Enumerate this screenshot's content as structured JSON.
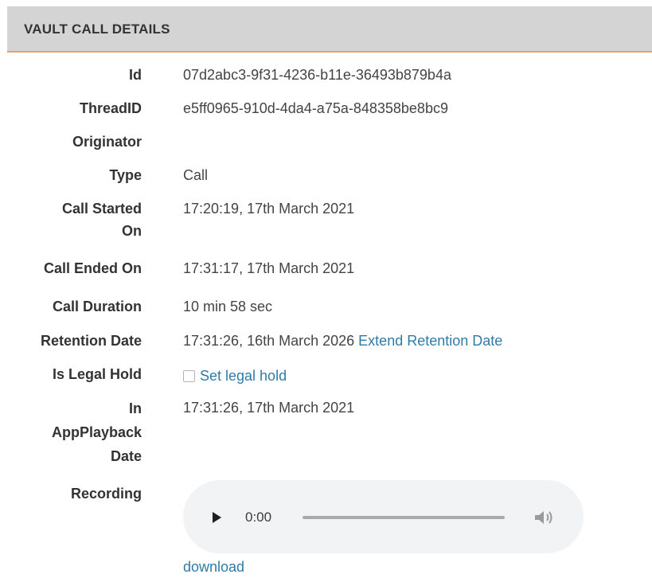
{
  "header": {
    "title": "VAULT CALL DETAILS"
  },
  "fields": {
    "id": {
      "label": "Id",
      "value": "07d2abc3-9f31-4236-b11e-36493b879b4a"
    },
    "thread_id": {
      "label": "ThreadID",
      "value": "e5ff0965-910d-4da4-a75a-848358be8bc9"
    },
    "originator": {
      "label": "Originator",
      "value": ""
    },
    "type": {
      "label": "Type",
      "value": "Call"
    },
    "call_started_on": {
      "label_line1": "Call Started",
      "label_line2": "On",
      "value": "17:20:19, 17th March 2021"
    },
    "call_ended_on": {
      "label": "Call Ended On",
      "value": "17:31:17, 17th March 2021"
    },
    "call_duration": {
      "label": "Call Duration",
      "value": "10 min 58 sec"
    },
    "retention_date": {
      "label": "Retention Date",
      "value": "17:31:26, 16th March 2026",
      "action_label": "Extend Retention Date"
    },
    "legal_hold": {
      "label": "Is Legal Hold",
      "checked": false,
      "checkbox_label": "Set legal hold"
    },
    "in_app_playback_date": {
      "label_line1": "In",
      "label_line2": "AppPlayback",
      "label_line3": "Date",
      "value": "17:31:26, 17th March 2021"
    },
    "recording": {
      "label": "Recording",
      "player": {
        "time": "0:00",
        "progress": 0,
        "play_icon": "play-icon",
        "volume_icon": "volume-icon"
      },
      "download_label": "download"
    }
  },
  "colors": {
    "header_bg": "#d4d4d4",
    "header_border": "#e8a36a",
    "link": "#2f7ba7"
  }
}
